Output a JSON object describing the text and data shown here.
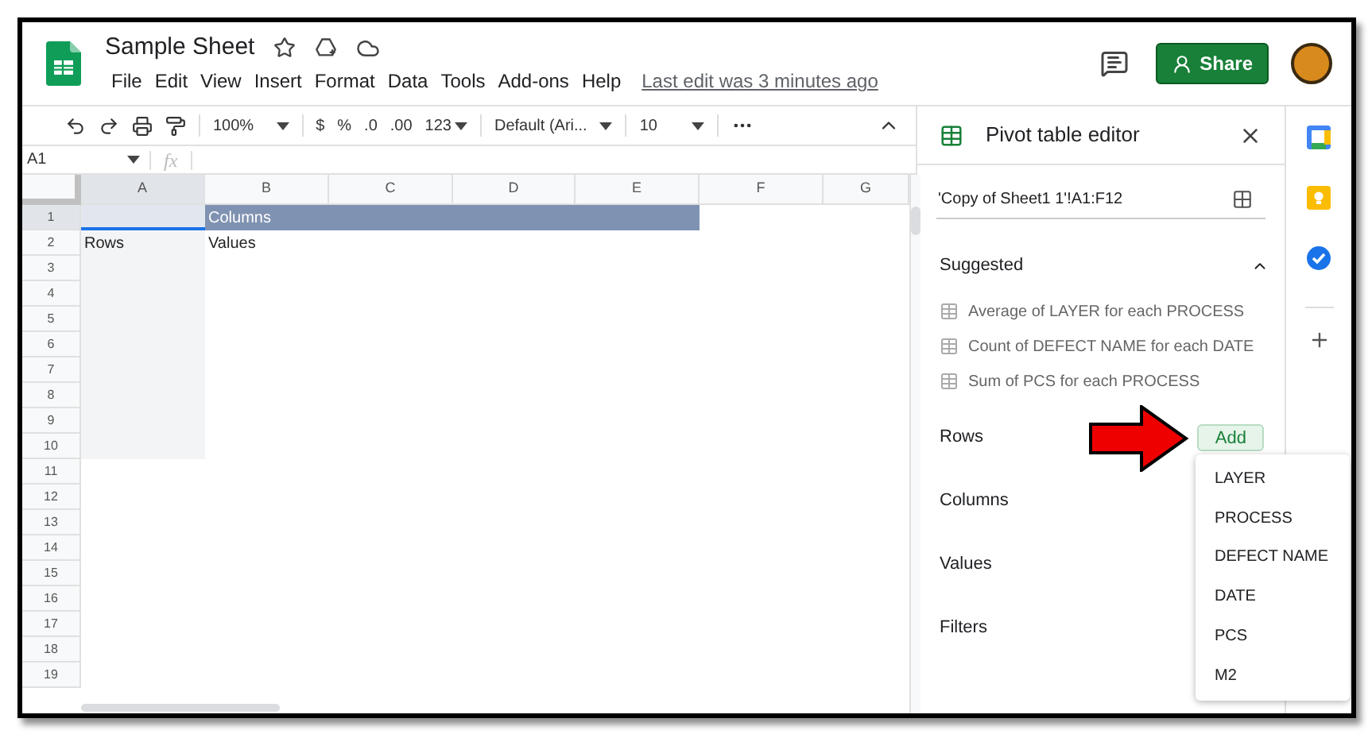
{
  "app": {
    "title": "Sample Sheet",
    "menu": [
      "File",
      "Edit",
      "View",
      "Insert",
      "Format",
      "Data",
      "Tools",
      "Add-ons",
      "Help"
    ],
    "last_edit": "Last edit was 3 minutes ago",
    "share_button": "Share"
  },
  "toolbar": {
    "zoom": "100%",
    "currency": "$",
    "percent": "%",
    "decrease_decimals": ".0",
    "increase_decimals": ".00",
    "more_formats": "123",
    "font": "Default (Ari...",
    "font_size": "10"
  },
  "formula_bar": {
    "cell_ref": "A1",
    "fx": "fx"
  },
  "sheet": {
    "columns": [
      {
        "label": "A",
        "selected": true
      },
      {
        "label": "B",
        "selected": false
      },
      {
        "label": "C",
        "selected": false
      },
      {
        "label": "D",
        "selected": false
      },
      {
        "label": "E",
        "selected": false
      },
      {
        "label": "F",
        "selected": false
      },
      {
        "label": "G",
        "selected": false
      }
    ],
    "rows": [
      {
        "label": "1",
        "selected": true
      },
      {
        "label": "2",
        "selected": false
      },
      {
        "label": "3",
        "selected": false
      },
      {
        "label": "4",
        "selected": false
      },
      {
        "label": "5",
        "selected": false
      },
      {
        "label": "6",
        "selected": false
      },
      {
        "label": "7",
        "selected": false
      },
      {
        "label": "8",
        "selected": false
      },
      {
        "label": "9",
        "selected": false
      },
      {
        "label": "10",
        "selected": false
      },
      {
        "label": "11",
        "selected": false
      },
      {
        "label": "12",
        "selected": false
      },
      {
        "label": "13",
        "selected": false
      },
      {
        "label": "14",
        "selected": false
      },
      {
        "label": "15",
        "selected": false
      },
      {
        "label": "16",
        "selected": false
      },
      {
        "label": "17",
        "selected": false
      },
      {
        "label": "18",
        "selected": false
      },
      {
        "label": "19",
        "selected": false
      }
    ],
    "columns_label": "Columns",
    "rows_label": "Rows",
    "values_label": "Values"
  },
  "pivot_editor": {
    "title": "Pivot table editor",
    "range": "'Copy of Sheet1 1'!A1:F12",
    "suggested_title": "Suggested",
    "expanded": true,
    "suggestions": [
      "Average of LAYER for each PROCESS",
      "Count of DEFECT NAME for each DATE",
      "Sum of PCS for each PROCESS"
    ],
    "sections": [
      {
        "label": "Rows",
        "add_button": "Add"
      },
      {
        "label": "Columns"
      },
      {
        "label": "Values"
      },
      {
        "label": "Filters"
      }
    ],
    "field_menu": [
      "LAYER",
      "PROCESS",
      "DEFECT NAME",
      "DATE",
      "PCS",
      "M2"
    ]
  }
}
